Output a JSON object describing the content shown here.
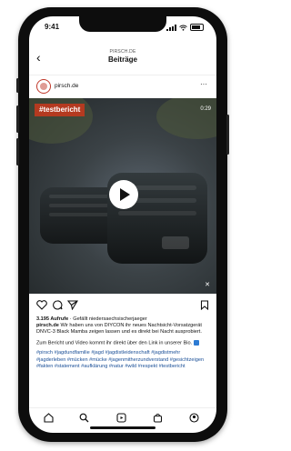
{
  "status": {
    "time": "9:41"
  },
  "header": {
    "subtitle": "PIRSCH.DE",
    "title": "Beiträge"
  },
  "post": {
    "username": "pirsch.de",
    "video": {
      "tag": "#testbericht",
      "duration": "0:29"
    },
    "views": "3.195 Aufrufe",
    "liked_by": "· Gefällt niedersaechsischerjaeger",
    "caption_user": "pirsch.de",
    "caption_text": "Wir haben uns von DIYCON ihr neues Nachtsicht-Vorsatzgerät DNVC-3 Black Mamba zeigen lassen und es direkt bei Nacht ausprobiert.",
    "caption_text2": "Zum Bericht und Video kommt ihr direkt über den Link in unserer Bio.",
    "hashtags": "#pirsch #jagdundfamilie #jagd #jagdistleidenschaft #jagdistmehr #jagderleben #mücken #mücke #jagenmitherzundverstand #gesichtzeigen #fakten #statement #aufklärung #natur #wild #respekt #testbericht"
  },
  "icons": {
    "back": "back-chevron-icon",
    "more": "more-options-icon",
    "like": "heart-icon",
    "comment": "comment-icon",
    "share": "send-icon",
    "save": "bookmark-icon",
    "play": "play-icon",
    "mute": "mute-icon",
    "nav": [
      "home-icon",
      "search-icon",
      "reels-icon",
      "shop-icon",
      "profile-icon"
    ]
  },
  "colors": {
    "tag_bg": "#b43a20",
    "hashtag": "#1a4f97",
    "avatar_ring": "#c0392b"
  }
}
